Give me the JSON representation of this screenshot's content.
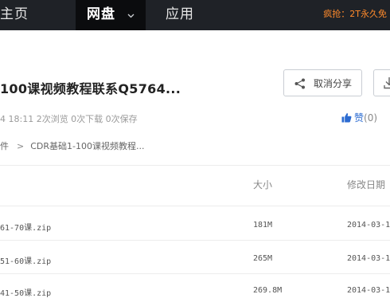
{
  "nav": {
    "home": "主页",
    "disk": "网盘",
    "app": "应用",
    "promo": "疯抢：2T永久免"
  },
  "share": {
    "title": "100课视频教程联系Q5764...",
    "meta": "4 18:11  2次浏览  0次下载  0次保存",
    "cancel_share_label": "取消分享",
    "like_label": "赞",
    "like_count": "(0)"
  },
  "breadcrumb": {
    "root": "件",
    "separator": ">",
    "current": "CDR基础1-100课视频教程..."
  },
  "table": {
    "columns": {
      "size": "大小",
      "modified": "修改日期"
    },
    "rows": [
      {
        "name": "61-70课.zip",
        "size": "181M",
        "date": "2014-03-1"
      },
      {
        "name": "51-60课.zip",
        "size": "265M",
        "date": "2014-03-1"
      },
      {
        "name": "41-50课.zip",
        "size": "269.8M",
        "date": "2014-03-1"
      }
    ]
  },
  "colors": {
    "nav_bg": "#1f2227",
    "promo": "#ff8a2b",
    "like": "#2b6bd1"
  },
  "icons": [
    "chevron-down-icon",
    "share-icon",
    "download-icon",
    "thumbs-up-icon"
  ]
}
